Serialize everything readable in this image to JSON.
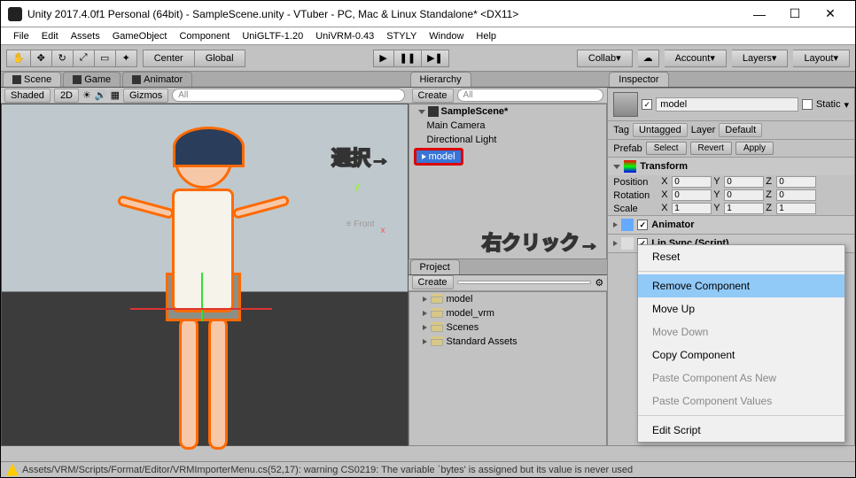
{
  "window": {
    "title": "Unity 2017.4.0f1 Personal (64bit) - SampleScene.unity - VTuber - PC, Mac & Linux Standalone* <DX11>"
  },
  "menubar": [
    "File",
    "Edit",
    "Assets",
    "GameObject",
    "Component",
    "UniGLTF-1.20",
    "UniVRM-0.43",
    "STYLY",
    "Window",
    "Help"
  ],
  "toolbar": {
    "center": "Center",
    "global": "Global",
    "collab": "Collab",
    "account": "Account",
    "layers": "Layers",
    "layout": "Layout"
  },
  "tabs": {
    "scene": "Scene",
    "game": "Game",
    "animator": "Animator",
    "hierarchy": "Hierarchy",
    "project": "Project",
    "inspector": "Inspector"
  },
  "sceneview": {
    "shaded": "Shaded",
    "mode2d": "2D",
    "gizmos": "Gizmos",
    "search": "All",
    "front": "≡ Front",
    "axis_y": "y",
    "axis_x": "x"
  },
  "hierarchy": {
    "create": "Create",
    "search": "All",
    "scene": "SampleScene*",
    "items": [
      "Main Camera",
      "Directional Light"
    ],
    "selected": "model"
  },
  "project": {
    "create": "Create",
    "items": [
      "model",
      "model_vrm",
      "Scenes",
      "Standard Assets"
    ]
  },
  "inspector": {
    "name": "model",
    "static": "Static",
    "tag_lbl": "Tag",
    "tag": "Untagged",
    "layer_lbl": "Layer",
    "layer": "Default",
    "prefab_lbl": "Prefab",
    "select": "Select",
    "revert": "Revert",
    "apply": "Apply",
    "transform": {
      "title": "Transform",
      "position": "Position",
      "px": "0",
      "py": "0",
      "pz": "0",
      "rotation": "Rotation",
      "rx": "0",
      "ry": "0",
      "rz": "0",
      "scale": "Scale",
      "sx": "1",
      "sy": "1",
      "sz": "1"
    },
    "animator": "Animator",
    "lipsync": "Lip Sync (Script)"
  },
  "context_menu": {
    "items": [
      {
        "label": "Reset",
        "disabled": false
      },
      {
        "sep": true
      },
      {
        "label": "Remove Component",
        "hover": true
      },
      {
        "label": "Move Up",
        "disabled": false
      },
      {
        "label": "Move Down",
        "disabled": true
      },
      {
        "label": "Copy Component",
        "disabled": false
      },
      {
        "label": "Paste Component As New",
        "disabled": true
      },
      {
        "label": "Paste Component Values",
        "disabled": true
      },
      {
        "sep": true
      },
      {
        "label": "Edit Script",
        "disabled": false
      }
    ]
  },
  "annotations": {
    "select": "選択→",
    "rightclick": "右クリック→"
  },
  "statusbar": {
    "msg": "Assets/VRM/Scripts/Format/Editor/VRMImporterMenu.cs(52,17): warning CS0219: The variable `bytes' is assigned but its value is never used"
  }
}
